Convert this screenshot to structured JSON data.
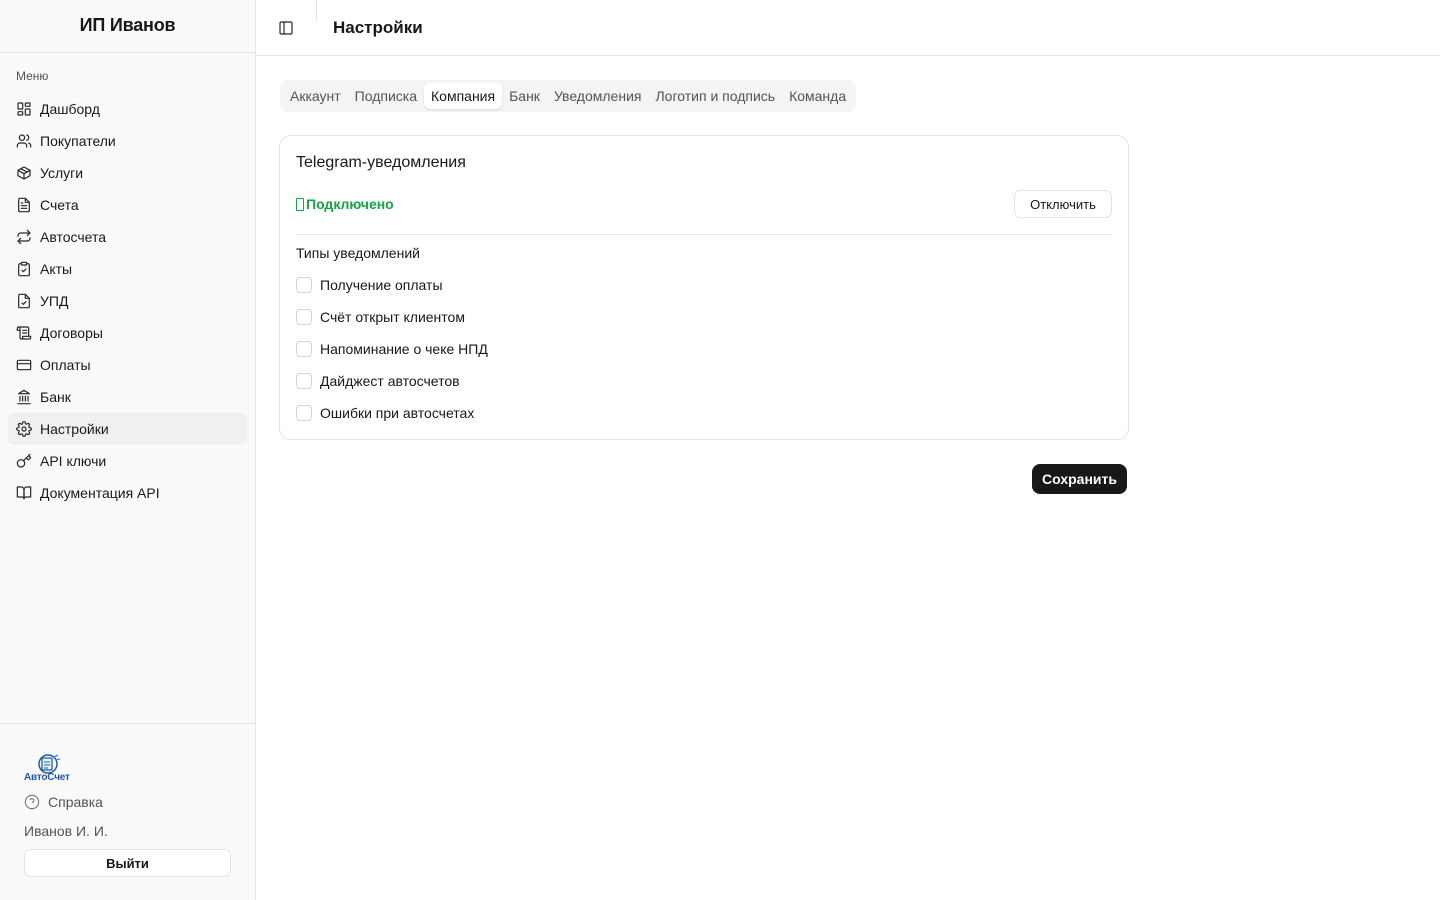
{
  "sidebar": {
    "company_name": "ИП Иванов",
    "menu_label": "Меню",
    "items": [
      {
        "label": "Дашборд",
        "icon": "dashboard-icon"
      },
      {
        "label": "Покупатели",
        "icon": "users-icon"
      },
      {
        "label": "Услуги",
        "icon": "package-icon"
      },
      {
        "label": "Счета",
        "icon": "file-text-icon"
      },
      {
        "label": "Автосчета",
        "icon": "repeat-icon"
      },
      {
        "label": "Акты",
        "icon": "clipboard-check-icon"
      },
      {
        "label": "УПД",
        "icon": "file-check-icon"
      },
      {
        "label": "Договоры",
        "icon": "scroll-icon"
      },
      {
        "label": "Оплаты",
        "icon": "credit-card-icon"
      },
      {
        "label": "Банк",
        "icon": "landmark-icon"
      },
      {
        "label": "Настройки",
        "icon": "gear-icon",
        "active": true
      },
      {
        "label": "API ключи",
        "icon": "key-icon"
      },
      {
        "label": "Документация API",
        "icon": "book-icon"
      }
    ],
    "logo_text": "АвтоСчет",
    "help_label": "Справка",
    "user_name": "Иванов И. И.",
    "logout_label": "Выйти"
  },
  "header": {
    "title": "Настройки"
  },
  "tabs": [
    {
      "label": "Аккаунт"
    },
    {
      "label": "Подписка"
    },
    {
      "label": "Компания",
      "active": true
    },
    {
      "label": "Банк"
    },
    {
      "label": "Уведомления"
    },
    {
      "label": "Логотип и подпись"
    },
    {
      "label": "Команда"
    }
  ],
  "telegram": {
    "title": "Telegram-уведомления",
    "status": "Подключено",
    "disconnect_label": "Отключить",
    "types_title": "Типы уведомлений",
    "options": [
      {
        "label": "Получение оплаты",
        "checked": false
      },
      {
        "label": "Счёт открыт клиентом",
        "checked": false
      },
      {
        "label": "Напоминание о чеке НПД",
        "checked": false
      },
      {
        "label": "Дайджест автосчетов",
        "checked": false
      },
      {
        "label": "Ошибки при автосчетах",
        "checked": false
      }
    ]
  },
  "save_label": "Сохранить",
  "colors": {
    "status_green": "#16a34a",
    "primary_button": "#18181b",
    "logo_blue": "#1e5aa8"
  }
}
